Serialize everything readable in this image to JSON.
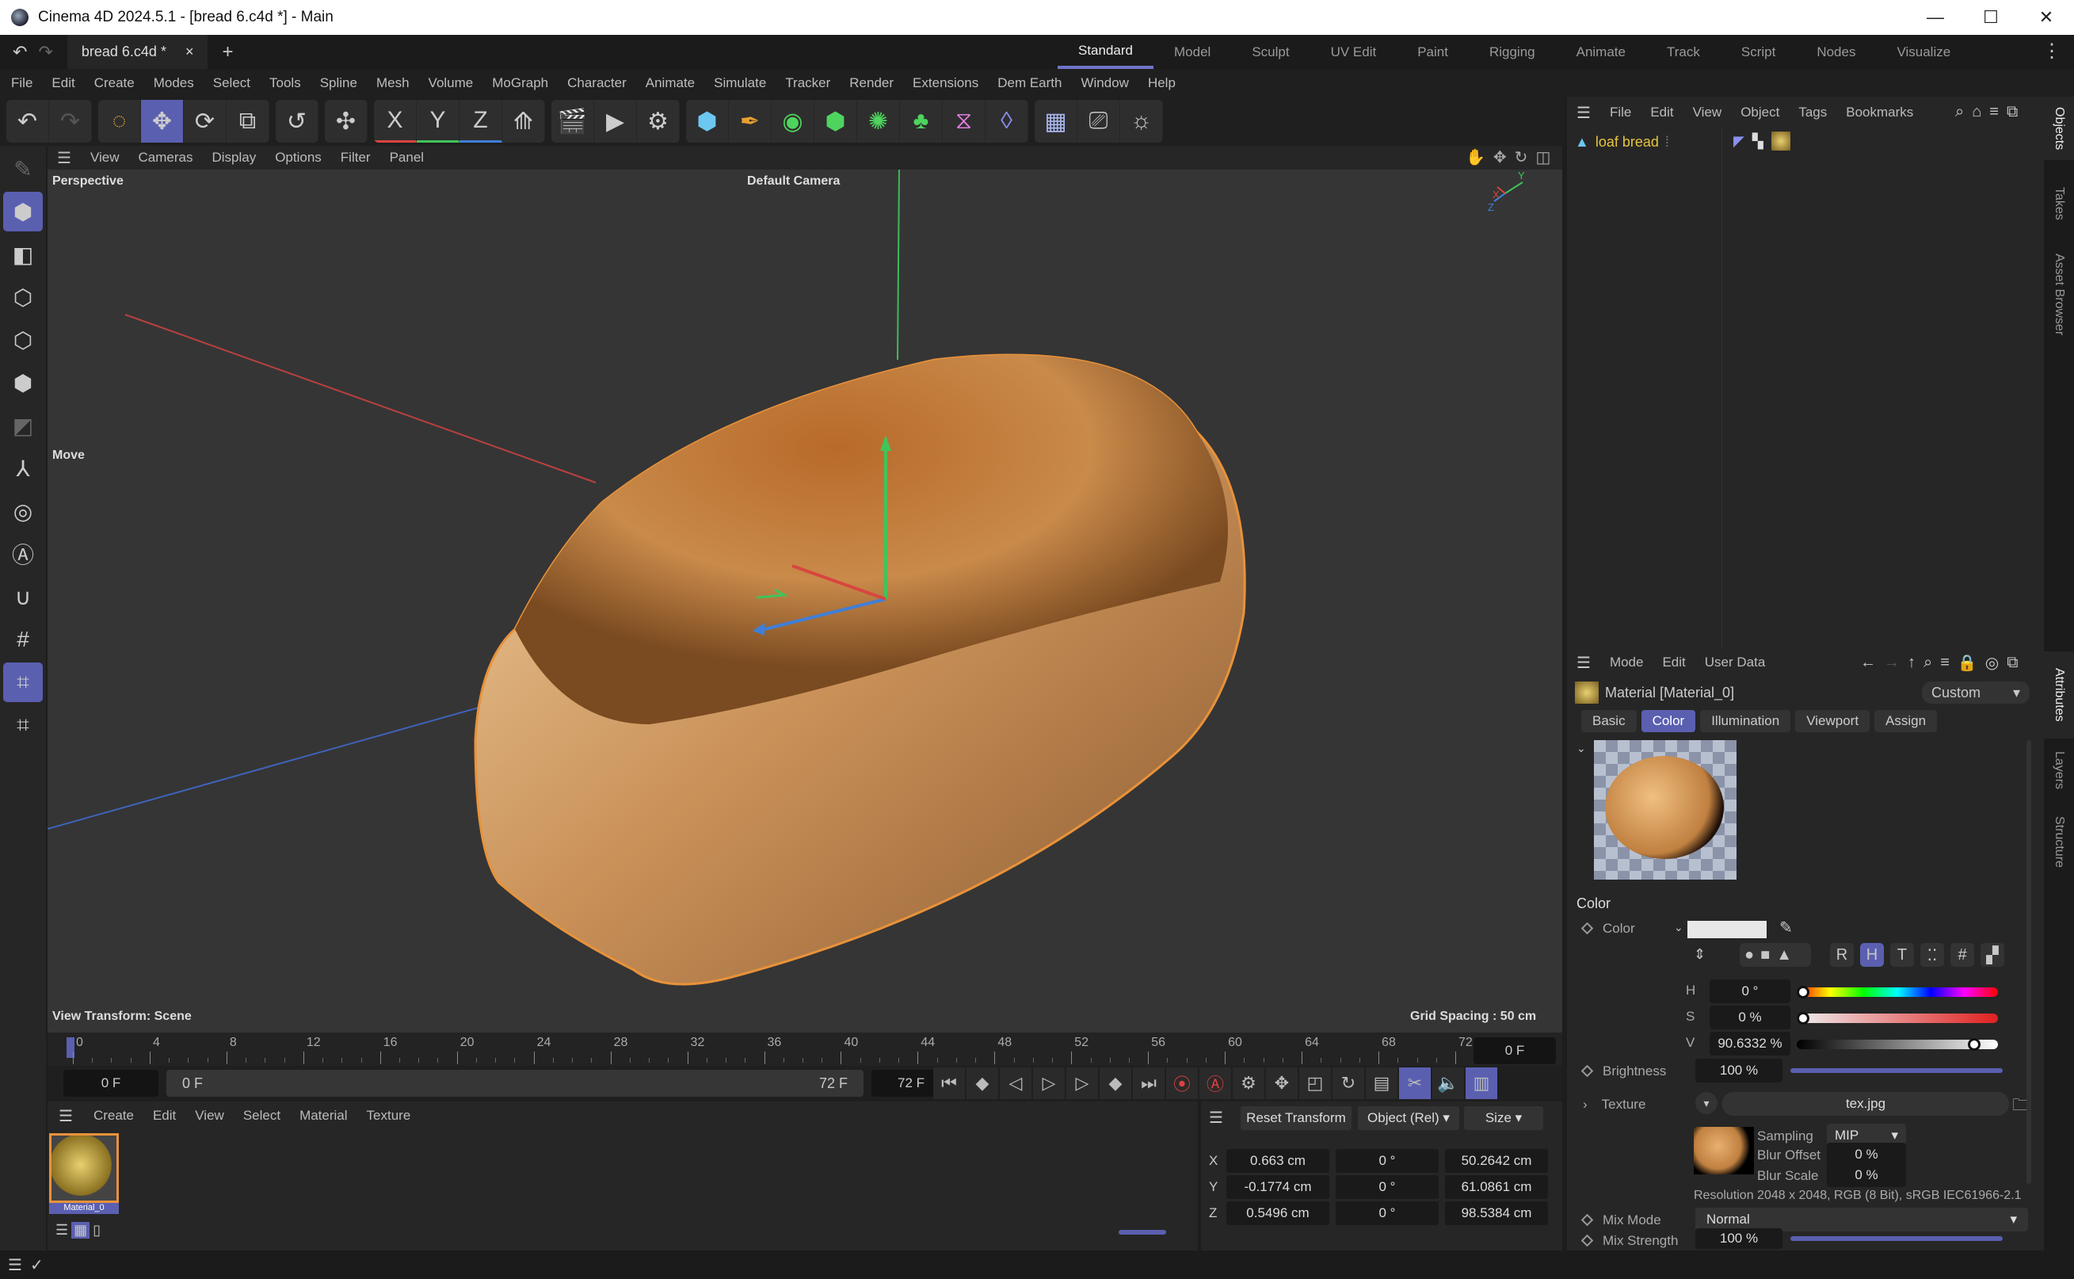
{
  "window": {
    "title": "Cinema 4D 2024.5.1 - [bread 6.c4d *] - Main",
    "minimize": "—",
    "maximize": "☐",
    "close": "✕"
  },
  "tabbar": {
    "doc_tab": "bread 6.c4d *",
    "close": "×",
    "add": "+",
    "layouts": [
      "Standard",
      "Model",
      "Sculpt",
      "UV Edit",
      "Paint",
      "Rigging",
      "Animate",
      "Track",
      "Script",
      "Nodes",
      "Visualize"
    ],
    "active_layout": "Standard"
  },
  "menu": [
    "File",
    "Edit",
    "Create",
    "Modes",
    "Select",
    "Tools",
    "Spline",
    "Mesh",
    "Volume",
    "MoGraph",
    "Character",
    "Animate",
    "Simulate",
    "Tracker",
    "Render",
    "Extensions",
    "Dem Earth",
    "Window",
    "Help"
  ],
  "toolbar": {
    "axes": [
      "X",
      "Y",
      "Z"
    ]
  },
  "viewport": {
    "menu": [
      "View",
      "Cameras",
      "Display",
      "Options",
      "Filter",
      "Panel"
    ],
    "projection": "Perspective",
    "camera": "Default Camera",
    "tool": "Move",
    "view_transform": "View Transform: Scene",
    "grid_spacing": "Grid Spacing : 50 cm",
    "axis_labels": [
      "X",
      "Y",
      "Z"
    ]
  },
  "timeline": {
    "ticks": [
      "0",
      "4",
      "8",
      "12",
      "16",
      "20",
      "24",
      "28",
      "32",
      "36",
      "40",
      "44",
      "48",
      "52",
      "56",
      "60",
      "64",
      "68",
      "72"
    ],
    "current_frame": "0 F",
    "start": "0 F",
    "range_start": "0 F",
    "range_end": "72 F",
    "end": "72 F"
  },
  "material_manager": {
    "menu": [
      "Create",
      "Edit",
      "View",
      "Select",
      "Material",
      "Texture"
    ],
    "materials": [
      {
        "name": "Material_0"
      }
    ]
  },
  "coordinates": {
    "reset": "Reset Transform",
    "mode": "Object (Rel)",
    "size_mode": "Size",
    "rows": [
      {
        "axis": "X",
        "pos": "0.663 cm",
        "rot": "0 °",
        "size": "50.2642 cm"
      },
      {
        "axis": "Y",
        "pos": "-0.1774 cm",
        "rot": "0 °",
        "size": "61.0861 cm"
      },
      {
        "axis": "Z",
        "pos": "0.5496 cm",
        "rot": "0 °",
        "size": "98.5384 cm"
      }
    ]
  },
  "objects": {
    "menu": [
      "File",
      "Edit",
      "View",
      "Object",
      "Tags",
      "Bookmarks"
    ],
    "items": [
      {
        "name": "loaf bread"
      }
    ]
  },
  "side_tabs": [
    "Objects",
    "Takes",
    "Asset Browser",
    "Attributes",
    "Layers",
    "Structure"
  ],
  "attributes": {
    "menu": [
      "Mode",
      "Edit",
      "User Data"
    ],
    "header": "Material [Material_0]",
    "preset": "Custom",
    "tabs": [
      "Basic",
      "Color",
      "Illumination",
      "Viewport",
      "Assign"
    ],
    "active_tab": "Color",
    "section": "Color",
    "color_label": "Color",
    "color_swatch": "#e7e7e7",
    "mode_buttons": [
      "R",
      "H",
      "T",
      "⁚⁚",
      "#",
      "▞"
    ],
    "h": {
      "label": "H",
      "value": "0 °",
      "fraction": 0
    },
    "s": {
      "label": "S",
      "value": "0 %",
      "fraction": 0
    },
    "v": {
      "label": "V",
      "value": "90.6332 %",
      "fraction": 0.906
    },
    "brightness": {
      "label": "Brightness",
      "value": "100 %",
      "fraction": 1
    },
    "texture": {
      "label": "Texture",
      "file": "tex.jpg",
      "sampling_label": "Sampling",
      "sampling": "MIP",
      "blur_offset_label": "Blur Offset",
      "blur_offset": "0 %",
      "blur_scale_label": "Blur Scale",
      "blur_scale": "0 %",
      "resolution": "Resolution 2048 x 2048, RGB (8 Bit), sRGB IEC61966-2.1"
    },
    "mix_mode": {
      "label": "Mix Mode",
      "value": "Normal"
    },
    "mix_strength": {
      "label": "Mix Strength",
      "value": "100 %",
      "fraction": 1
    }
  },
  "colors": {
    "accent": "#5a5fb0",
    "selected_object": "#e8c440",
    "x_axis": "#d9453f",
    "y_axis": "#3fc45a",
    "z_axis": "#3f7fd9"
  }
}
